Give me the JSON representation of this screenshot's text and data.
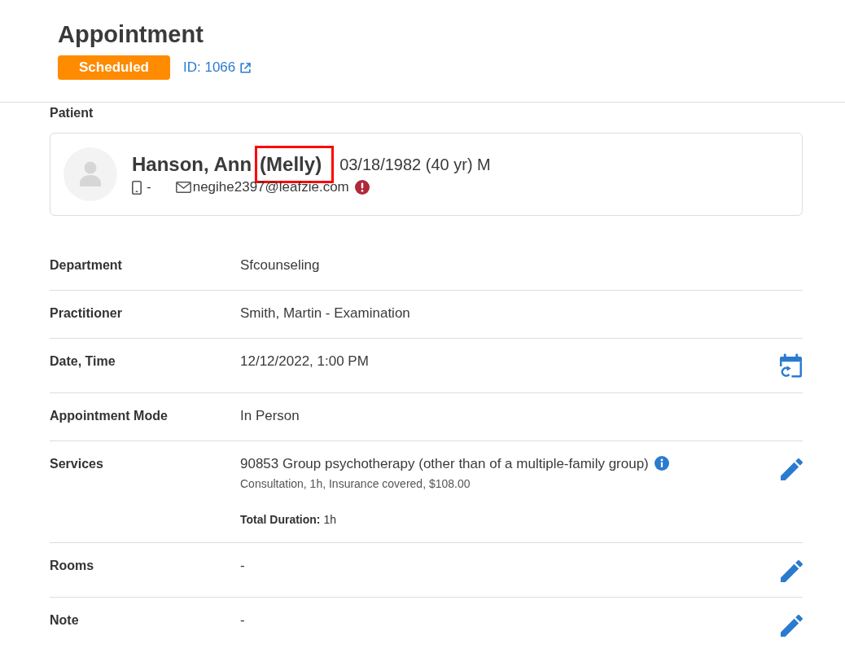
{
  "header": {
    "title": "Appointment",
    "status": {
      "label": "Scheduled",
      "kind": "scheduled"
    },
    "id_link": "ID: 1066"
  },
  "patient": {
    "section_label": "Patient",
    "name": "Hanson, Ann",
    "nickname": {
      "text": "(Melly)",
      "highlighted": true
    },
    "demographics": "03/18/1982 (40 yr) M",
    "phone": "-",
    "email": "negihe2397@leafzie.com"
  },
  "details": [
    {
      "kind": "text",
      "label": "Department",
      "value": "Sfcounseling",
      "editable": false,
      "reschedulable": false
    },
    {
      "kind": "text",
      "label": "Practitioner",
      "value": "Smith, Martin - Examination",
      "editable": false,
      "reschedulable": false
    },
    {
      "kind": "text",
      "label": "Date, Time",
      "value": "12/12/2022, 1:00 PM",
      "editable": false,
      "reschedulable": true
    },
    {
      "kind": "text",
      "label": "Appointment Mode",
      "value": "In Person",
      "editable": false,
      "reschedulable": false
    },
    {
      "kind": "services",
      "label": "Services",
      "services": [
        {
          "name": "90853 Group psychotherapy (other than of a multiple-family group)",
          "details": "Consultation, 1h, Insurance covered, $108.00"
        }
      ],
      "total": "**Total Duration:** 1h",
      "editable": true,
      "reschedulable": false
    },
    {
      "kind": "text",
      "label": "Rooms",
      "value": "-",
      "editable": true,
      "reschedulable": false
    },
    {
      "kind": "text",
      "label": "Note",
      "value": "-",
      "editable": true,
      "reschedulable": false
    }
  ]
}
